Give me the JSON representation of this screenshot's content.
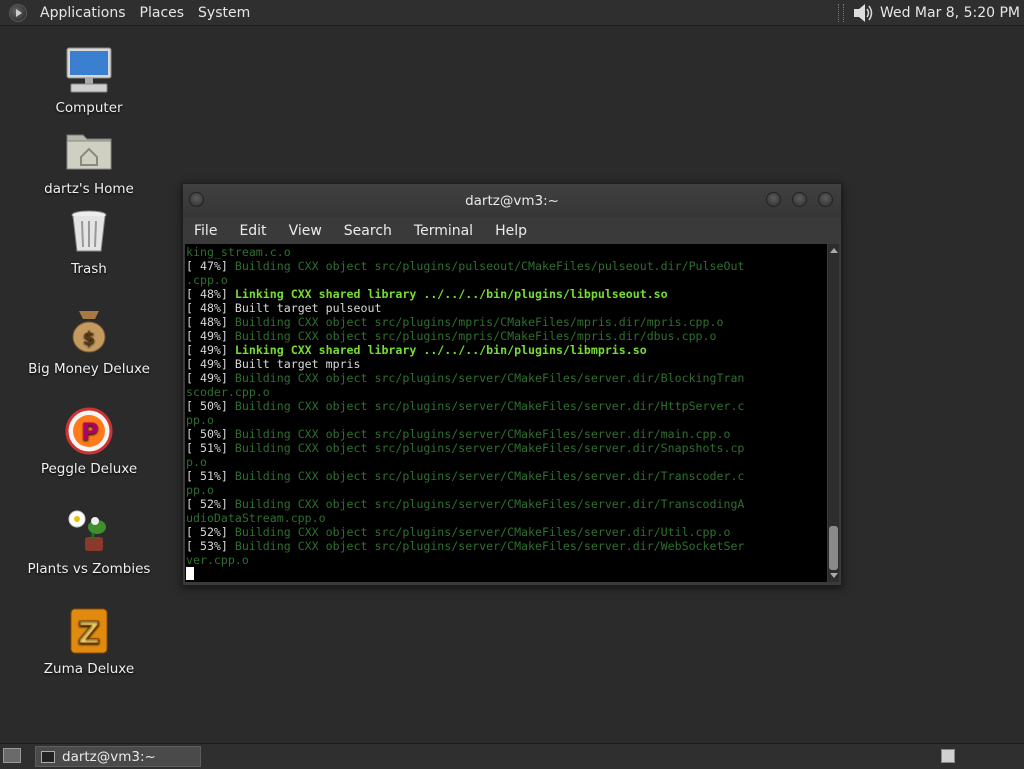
{
  "top_panel": {
    "menus": [
      "Applications",
      "Places",
      "System"
    ],
    "clock": "Wed Mar  8,  5:20 PM"
  },
  "desktop_icons": [
    {
      "label": "Computer",
      "icon": "computer-icon"
    },
    {
      "label": "dartz's Home",
      "icon": "home-folder-icon"
    },
    {
      "label": "Trash",
      "icon": "trash-icon"
    },
    {
      "label": "Big Money Deluxe",
      "icon": "money-bag-icon"
    },
    {
      "label": "Peggle Deluxe",
      "icon": "peggle-icon"
    },
    {
      "label": "Plants vs Zombies",
      "icon": "plants-vs-zombies-icon"
    },
    {
      "label": "Zuma Deluxe",
      "icon": "zuma-icon"
    }
  ],
  "terminal": {
    "title": "dartz@vm3:~",
    "menu": [
      "File",
      "Edit",
      "View",
      "Search",
      "Terminal",
      "Help"
    ],
    "lines": [
      {
        "type": "dim",
        "prefix": "",
        "text": "king_stream.c.o"
      },
      {
        "type": "dim",
        "prefix": "[ 47%] ",
        "text": "Building CXX object src/plugins/pulseout/CMakeFiles/pulseout.dir/PulseOut"
      },
      {
        "type": "dim",
        "prefix": "",
        "text": ".cpp.o"
      },
      {
        "type": "link",
        "prefix": "[ 48%] ",
        "text": "Linking CXX shared library ../../../bin/plugins/libpulseout.so"
      },
      {
        "type": "plain",
        "prefix": "[ 48%] ",
        "text": "Built target pulseout"
      },
      {
        "type": "dim",
        "prefix": "[ 48%] ",
        "text": "Building CXX object src/plugins/mpris/CMakeFiles/mpris.dir/mpris.cpp.o"
      },
      {
        "type": "dim",
        "prefix": "[ 49%] ",
        "text": "Building CXX object src/plugins/mpris/CMakeFiles/mpris.dir/dbus.cpp.o"
      },
      {
        "type": "link",
        "prefix": "[ 49%] ",
        "text": "Linking CXX shared library ../../../bin/plugins/libmpris.so"
      },
      {
        "type": "plain",
        "prefix": "[ 49%] ",
        "text": "Built target mpris"
      },
      {
        "type": "dim",
        "prefix": "[ 49%] ",
        "text": "Building CXX object src/plugins/server/CMakeFiles/server.dir/BlockingTran"
      },
      {
        "type": "dim",
        "prefix": "",
        "text": "scoder.cpp.o"
      },
      {
        "type": "dim",
        "prefix": "[ 50%] ",
        "text": "Building CXX object src/plugins/server/CMakeFiles/server.dir/HttpServer.c"
      },
      {
        "type": "dim",
        "prefix": "",
        "text": "pp.o"
      },
      {
        "type": "dim",
        "prefix": "[ 50%] ",
        "text": "Building CXX object src/plugins/server/CMakeFiles/server.dir/main.cpp.o"
      },
      {
        "type": "dim",
        "prefix": "[ 51%] ",
        "text": "Building CXX object src/plugins/server/CMakeFiles/server.dir/Snapshots.cp"
      },
      {
        "type": "dim",
        "prefix": "",
        "text": "p.o"
      },
      {
        "type": "dim",
        "prefix": "[ 51%] ",
        "text": "Building CXX object src/plugins/server/CMakeFiles/server.dir/Transcoder.c"
      },
      {
        "type": "dim",
        "prefix": "",
        "text": "pp.o"
      },
      {
        "type": "dim",
        "prefix": "[ 52%] ",
        "text": "Building CXX object src/plugins/server/CMakeFiles/server.dir/TranscodingA"
      },
      {
        "type": "dim",
        "prefix": "",
        "text": "udioDataStream.cpp.o"
      },
      {
        "type": "dim",
        "prefix": "[ 52%] ",
        "text": "Building CXX object src/plugins/server/CMakeFiles/server.dir/Util.cpp.o"
      },
      {
        "type": "dim",
        "prefix": "[ 53%] ",
        "text": "Building CXX object src/plugins/server/CMakeFiles/server.dir/WebSocketSer"
      },
      {
        "type": "dim",
        "prefix": "",
        "text": "ver.cpp.o"
      }
    ]
  },
  "taskbar": {
    "task_label": "dartz@vm3:~"
  },
  "colors": {
    "desktop": "#2b2b2b",
    "panel": "#2f2f2f",
    "term_bg": "#000000",
    "term_dim": "#2f6f2f",
    "term_link": "#77dd33"
  }
}
